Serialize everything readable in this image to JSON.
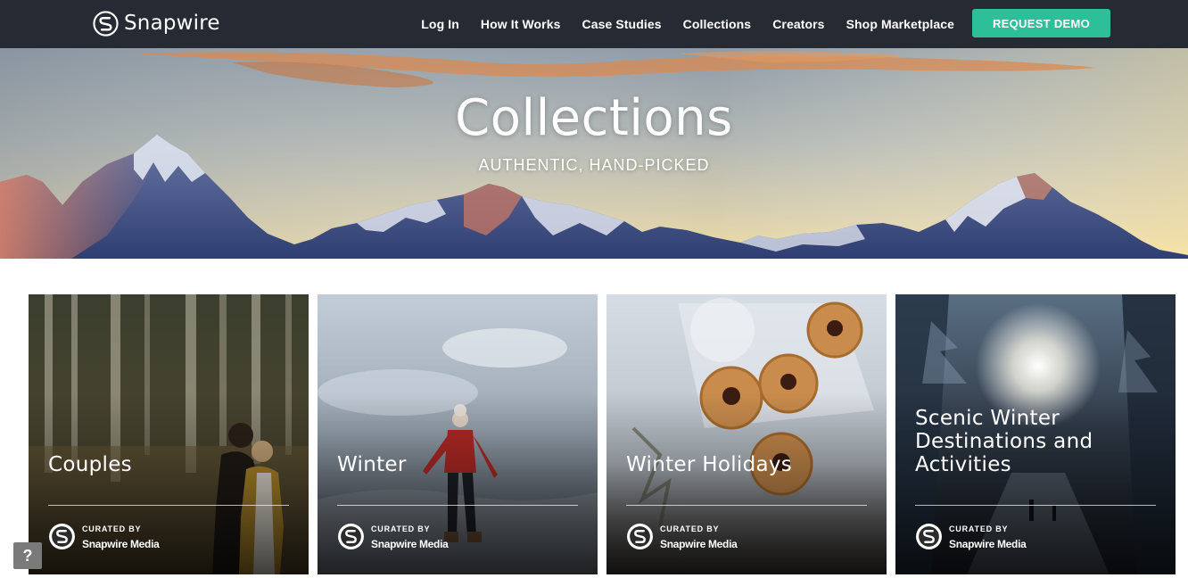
{
  "nav": {
    "brand": "Snapwire",
    "brand_icon": "snapwire-s-logo-icon",
    "links": [
      "Log In",
      "How It Works",
      "Case Studies",
      "Collections",
      "Creators",
      "Shop Marketplace"
    ],
    "demo_label": "REQUEST DEMO",
    "demo_color": "#2dbf9a",
    "background": "#252a33"
  },
  "hero": {
    "title": "Collections",
    "subtitle": "AUTHENTIC, HAND-PICKED"
  },
  "cards": [
    {
      "title": "Couples",
      "curated_label": "CURATED BY",
      "curator": "Snapwire Media"
    },
    {
      "title": "Winter",
      "curated_label": "CURATED BY",
      "curator": "Snapwire Media"
    },
    {
      "title": "Winter Holidays",
      "curated_label": "CURATED BY",
      "curator": "Snapwire Media"
    },
    {
      "title": "Scenic Winter Destinations and Activities",
      "curated_label": "CURATED BY",
      "curator": "Snapwire Media"
    }
  ],
  "help": {
    "label": "?",
    "icon": "question-icon"
  }
}
